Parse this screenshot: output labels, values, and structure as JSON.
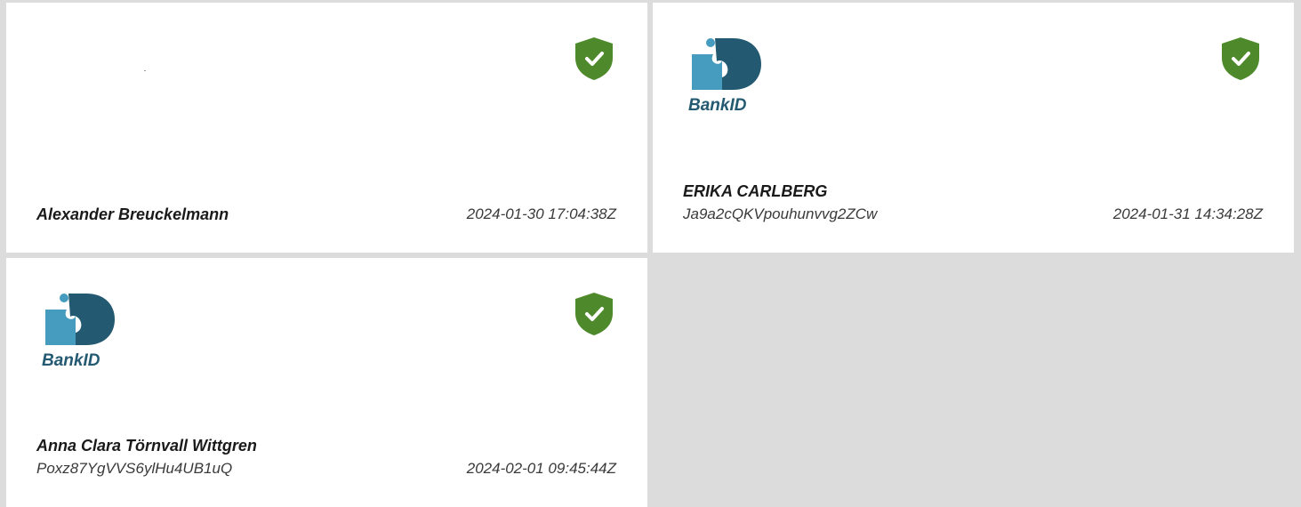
{
  "colors": {
    "background": "#dcdcdc",
    "card": "#ffffff",
    "shield": "#4e8a2b",
    "bankid_dark": "#235971",
    "bankid_light": "#469cbe"
  },
  "signatures": [
    {
      "name": "Alexander Breuckelmann",
      "identifier": "",
      "timestamp": "2024-01-30 17:04:38Z",
      "logo": "",
      "status_icon": "verified-shield-icon"
    },
    {
      "name": "ERIKA CARLBERG",
      "identifier": "Ja9a2cQKVpouhunvvg2ZCw",
      "timestamp": "2024-01-31 14:34:28Z",
      "logo": "BankID",
      "status_icon": "verified-shield-icon"
    },
    {
      "name": "Anna Clara Törnvall Wittgren",
      "identifier": "Poxz87YgVVS6ylHu4UB1uQ",
      "timestamp": "2024-02-01 09:45:44Z",
      "logo": "BankID",
      "status_icon": "verified-shield-icon"
    }
  ]
}
